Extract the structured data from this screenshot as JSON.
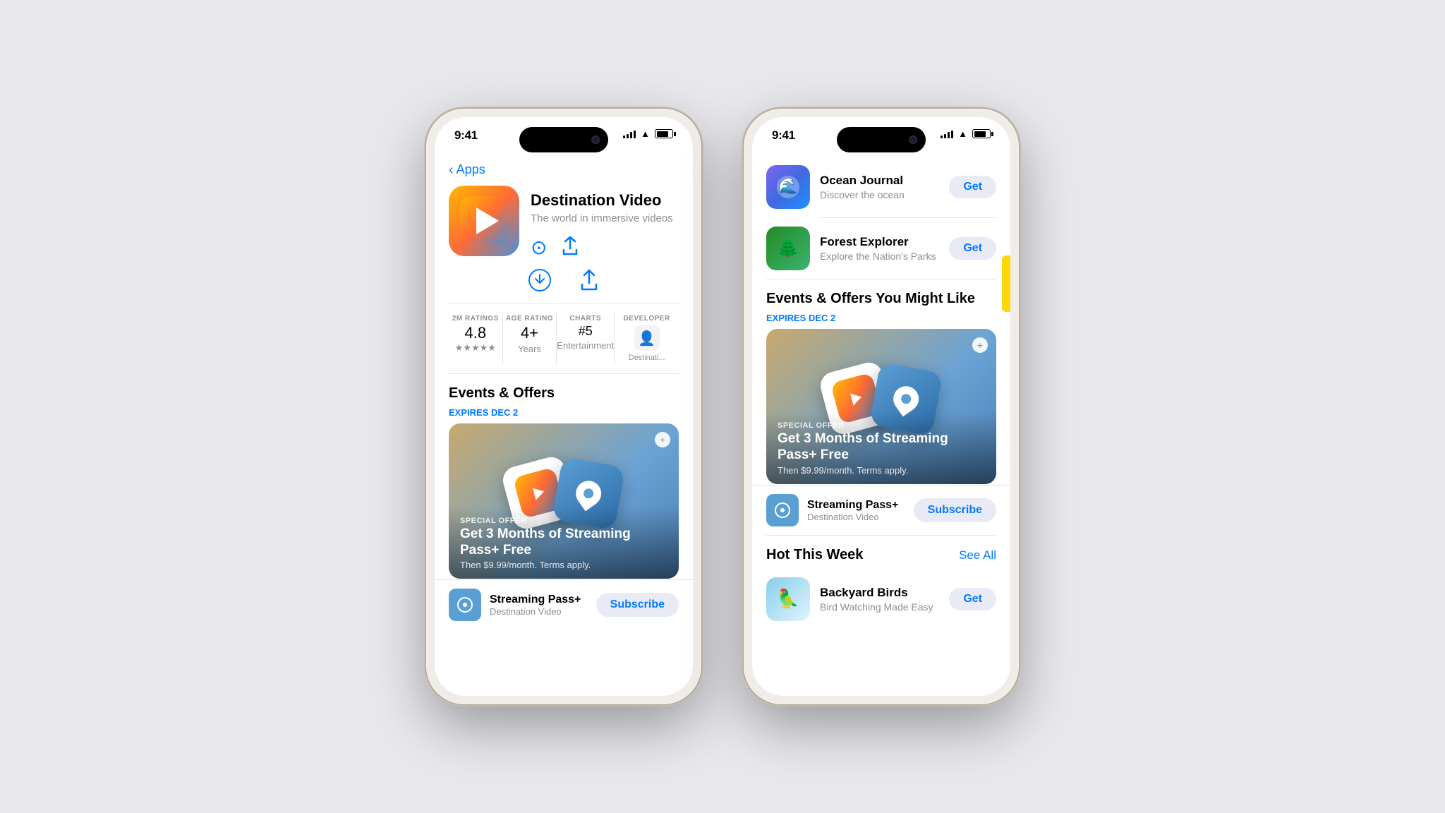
{
  "scene": {
    "background_color": "#e8e8ed"
  },
  "phone1": {
    "status_bar": {
      "time": "9:41",
      "signal_bars": [
        3,
        5,
        7,
        9,
        11
      ],
      "wifi": "wifi",
      "battery": "battery"
    },
    "nav": {
      "back_label": "Apps"
    },
    "app": {
      "name": "Destination Video",
      "subtitle": "The world in immersive videos",
      "download_icon": "⬇",
      "share_icon": "⬆"
    },
    "ratings": {
      "count_label": "2M Ratings",
      "count_value": "4.8",
      "stars": "★★★★★",
      "age_label": "Age Rating",
      "age_value": "4+",
      "age_sub": "Years",
      "chart_label": "Charts",
      "chart_value": "#5",
      "chart_sub": "Entertainment",
      "dev_label": "Developer",
      "dev_sub": "Destinati..."
    },
    "events": {
      "section_title": "Events & Offers",
      "expires_label": "EXPIRES DEC 2",
      "card": {
        "offer_label": "SPECIAL OFFER",
        "title": "Get 3 Months of Streaming Pass+ Free",
        "subtitle": "Then $9.99/month. Terms apply.",
        "plus_badge": "+"
      },
      "subscribe_row": {
        "app_name": "Streaming Pass+",
        "app_sub": "Destination Video",
        "btn_label": "Subscribe"
      }
    }
  },
  "phone2": {
    "status_bar": {
      "time": "9:41"
    },
    "app_list": [
      {
        "id": "ocean-journal",
        "name": "Ocean Journal",
        "desc": "Discover the ocean",
        "btn": "Get"
      },
      {
        "id": "forest-explorer",
        "name": "Forest Explorer",
        "desc": "Explore the Nation's Parks",
        "btn": "Get"
      }
    ],
    "events": {
      "section_title": "Events & Offers You Might Like",
      "expires_label": "EXPIRES DEC 2",
      "card": {
        "offer_label": "SPECIAL OFFER",
        "title": "Get 3 Months of Streaming Pass+ Free",
        "subtitle": "Then $9.99/month. Terms apply.",
        "plus_badge": "+"
      },
      "subscribe_row": {
        "app_name": "Streaming Pass+",
        "app_sub": "Destination Video",
        "btn_label": "Subscribe"
      }
    },
    "hot_section": {
      "title": "Hot This Week",
      "see_all": "See All",
      "apps": [
        {
          "id": "backyard-birds",
          "name": "Backyard Birds",
          "desc": "Bird Watching Made Easy",
          "btn": "Get"
        }
      ]
    }
  }
}
